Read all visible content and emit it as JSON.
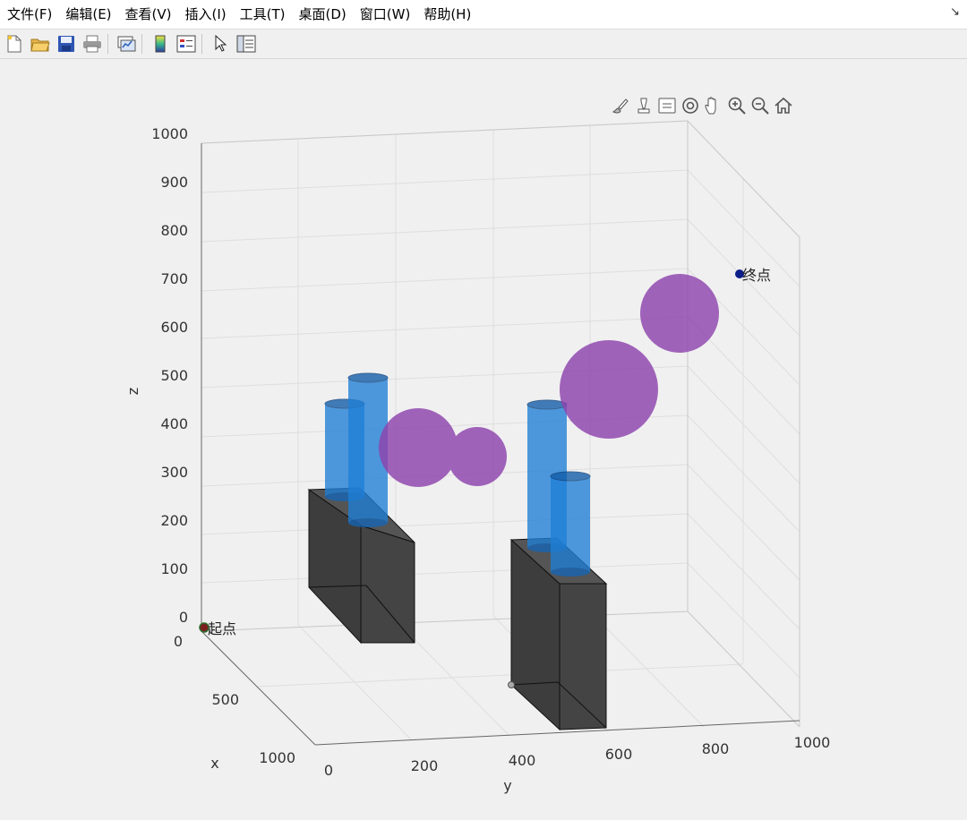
{
  "menu": {
    "items": [
      {
        "label": "文件(F)"
      },
      {
        "label": "编辑(E)"
      },
      {
        "label": "查看(V)"
      },
      {
        "label": "插入(I)"
      },
      {
        "label": "工具(T)"
      },
      {
        "label": "桌面(D)"
      },
      {
        "label": "窗口(W)"
      },
      {
        "label": "帮助(H)"
      }
    ]
  },
  "toolbar": {
    "icons": [
      "new-figure-icon",
      "open-file-icon",
      "save-icon",
      "print-icon",
      "link-plot-icon",
      "insert-colorbar-icon",
      "insert-legend-icon",
      "edit-plot-arrow-icon",
      "property-inspector-icon"
    ]
  },
  "axes_toolbar": {
    "icons": [
      "brush-icon",
      "data-tips-icon",
      "rotate-3d-icon",
      "pan-icon",
      "zoom-in-icon",
      "zoom-out-icon",
      "restore-view-icon"
    ]
  },
  "plot": {
    "z_ticks": [
      "0",
      "100",
      "200",
      "300",
      "400",
      "500",
      "600",
      "700",
      "800",
      "900",
      "1000"
    ],
    "x_ticks": [
      "0",
      "500",
      "1000"
    ],
    "y_ticks": [
      "0",
      "200",
      "400",
      "600",
      "800",
      "1000"
    ],
    "xlabel": "x",
    "ylabel": "y",
    "zlabel": "z",
    "start_label": "起点",
    "end_label": "终点",
    "colors": {
      "cylinder": "#1f7fd6",
      "sphere": "#8e44ad",
      "box": "#3a3a3a",
      "end_marker": "#0d1f8a",
      "start_marker": "#7a1f1f"
    }
  }
}
